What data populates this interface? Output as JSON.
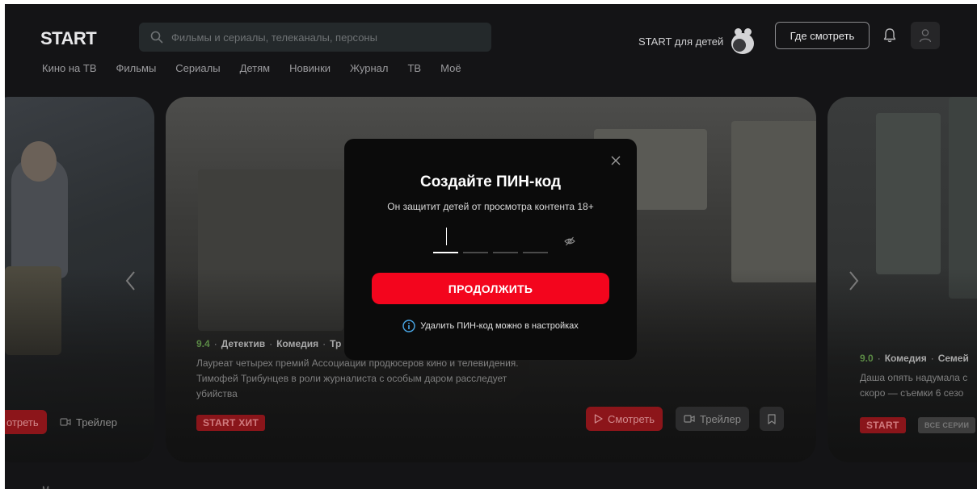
{
  "header": {
    "logo": "START",
    "search_placeholder": "Фильмы и сериалы, телеканалы, персоны",
    "kids_label": "START для детей",
    "where_to_watch": "Где смотреть"
  },
  "nav": [
    "Кино на ТВ",
    "Фильмы",
    "Сериалы",
    "Детям",
    "Новинки",
    "Журнал",
    "ТВ",
    "Моё"
  ],
  "carousel": {
    "left": {
      "watch_partial": "отреть",
      "trailer": "Трейлер"
    },
    "main": {
      "rating": "9.4",
      "genres": [
        "Детектив",
        "Комедия",
        "Тр"
      ],
      "description_lines": [
        "Лауреат четырех премий Ассоциации продюсеров кино и телевидения.",
        "Тимофей Трибунцев в роли журналиста с особым даром расследует",
        "убийства"
      ],
      "badge": "START ХИТ",
      "watch": "Смотреть",
      "trailer": "Трейлер"
    },
    "right": {
      "rating": "9.0",
      "genres": [
        "Комедия",
        "Семей"
      ],
      "description_lines": [
        "Даша опять надумала с",
        "скоро — съемки 6 сезо"
      ],
      "badge": "START",
      "badge2": "ВСЕ СЕРИИ"
    }
  },
  "modal": {
    "title": "Создайте ПИН-код",
    "subtitle": "Он защитит детей от просмотра контента 18+",
    "continue_label": "ПРОДОЛЖИТЬ",
    "info_text": "Удалить ПИН-код можно в настройках"
  },
  "bottom_peek": "М",
  "colors": {
    "accent": "#f3051d",
    "background": "#141416",
    "modal_bg": "#0b0b0b",
    "rating_green": "#5b8a45",
    "info_blue": "#4aa8e8"
  }
}
